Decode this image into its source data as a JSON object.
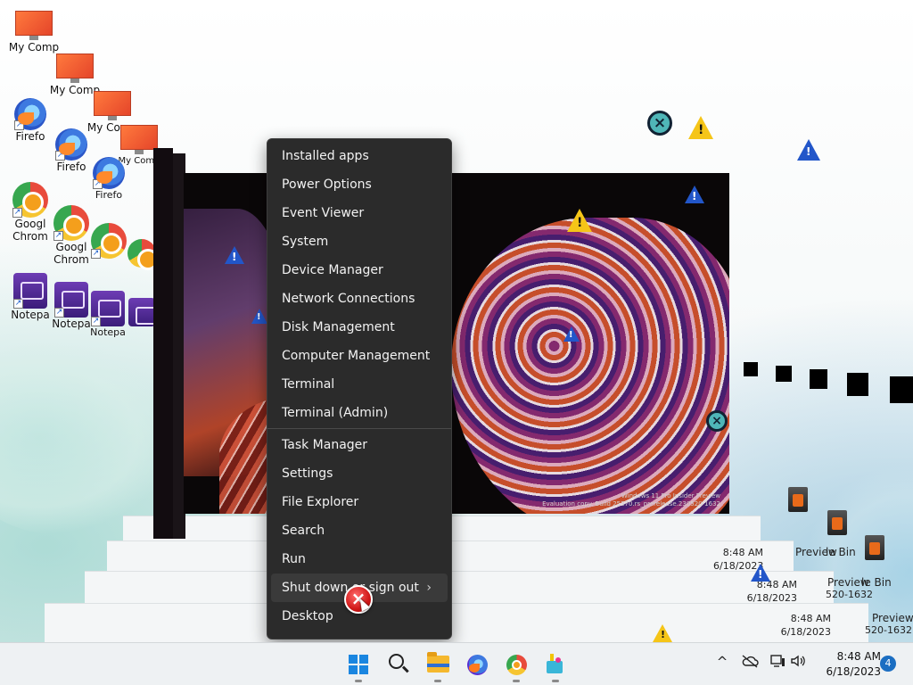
{
  "desktop": {
    "icons": [
      {
        "label": "My Comp",
        "type": "computer"
      },
      {
        "label": "Firefo",
        "type": "firefox"
      },
      {
        "label": "Googl Chrom",
        "type": "chrome"
      },
      {
        "label": "Notepa",
        "type": "notepad"
      }
    ],
    "recycle_bin_label": "le Bin",
    "preview_label": "Preview",
    "build_label": "520-1632",
    "watermark_line1": "Windows 11 Pro Insider Preview",
    "watermark_line2": "Evaluation copy. Build 25370.rs_prerelease.230520-1632"
  },
  "context_menu": {
    "items_group1": [
      "Installed apps",
      "Power Options",
      "Event Viewer",
      "System",
      "Device Manager",
      "Network Connections",
      "Disk Management",
      "Computer Management",
      "Terminal",
      "Terminal (Admin)"
    ],
    "items_group2": [
      "Task Manager",
      "Settings",
      "File Explorer",
      "Search",
      "Run"
    ],
    "shutdown_label": "Shut down or sign out",
    "shutdown_chevron": "›",
    "desktop_label": "Desktop"
  },
  "taskbar": {
    "time": "8:48 AM",
    "date": "6/18/2023",
    "notification_count": "4",
    "apps": [
      "start-icon",
      "search-icon",
      "file-explorer-icon",
      "firefox-icon",
      "chrome-icon",
      "paint-icon"
    ],
    "tray_overflow_glyph": "^",
    "tray_icons": [
      "onedrive-icon",
      "network-icon",
      "volume-icon"
    ]
  },
  "colors": {
    "menu_bg": "#2b2b2b",
    "menu_text": "#f2f2f2",
    "taskbar_bg": "#eef1f3",
    "accent": "#1a86e0",
    "badge": "#1b6ec2"
  }
}
